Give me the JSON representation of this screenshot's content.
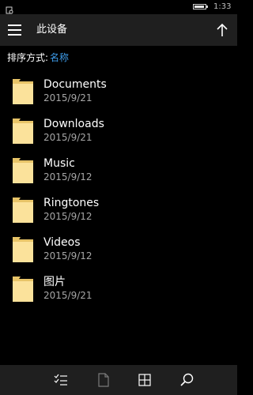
{
  "status_bar": {
    "time": "1:33",
    "battery_level": 0.9,
    "left_icon": "notification-icon"
  },
  "header": {
    "title": "此设备",
    "menu_icon": "hamburger-menu-icon",
    "up_icon": "arrow-up-icon"
  },
  "sort": {
    "label": "排序方式:",
    "value": "名称"
  },
  "files": [
    {
      "name": "Documents",
      "date": "2015/9/21",
      "icon": "folder-icon"
    },
    {
      "name": "Downloads",
      "date": "2015/9/21",
      "icon": "folder-icon"
    },
    {
      "name": "Music",
      "date": "2015/9/12",
      "icon": "folder-icon"
    },
    {
      "name": "Ringtones",
      "date": "2015/9/12",
      "icon": "folder-icon"
    },
    {
      "name": "Videos",
      "date": "2015/9/12",
      "icon": "folder-icon"
    },
    {
      "name": "图片",
      "date": "2015/9/21",
      "icon": "folder-icon"
    }
  ],
  "app_bar": {
    "buttons": [
      "select-list-icon",
      "new-document-icon",
      "grid-view-icon",
      "search-icon"
    ]
  },
  "colors": {
    "background": "#000000",
    "bar_background": "#1f1f1f",
    "accent": "#3d9be9",
    "folder": "#fbe29b",
    "folder_back": "#e8c468",
    "secondary_text": "#a6a6a6"
  }
}
